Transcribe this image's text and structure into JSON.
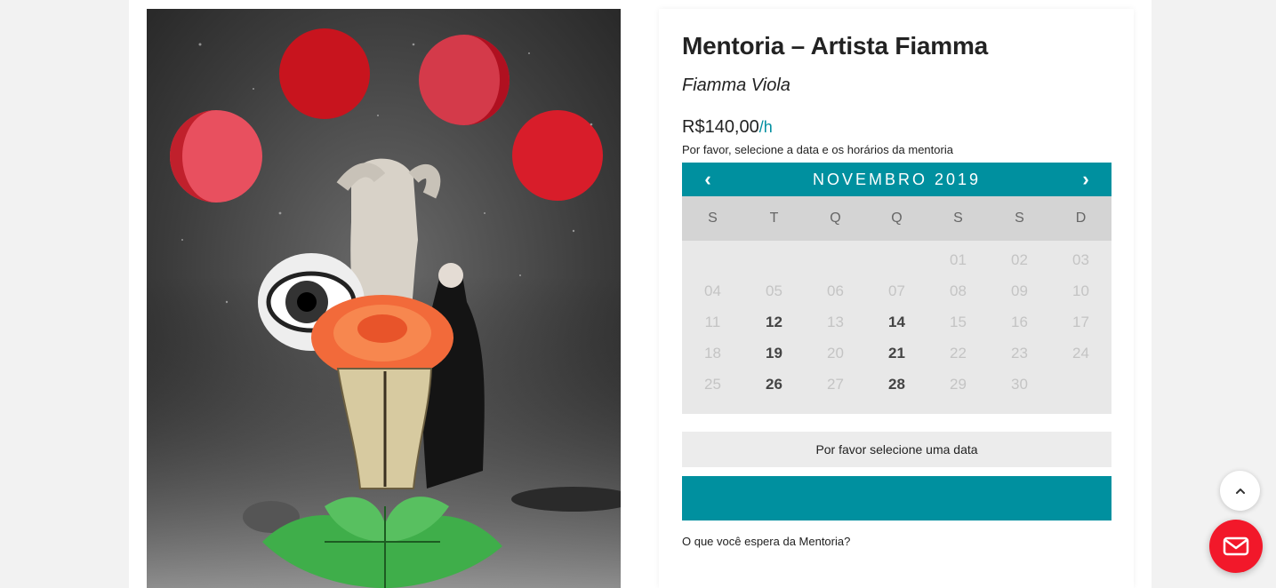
{
  "product": {
    "title": "Mentoria – Artista Fiamma",
    "artist": "Fiamma Viola",
    "price": "R$140,00",
    "price_unit": "/h",
    "instructions": "Por favor, selecione a data e os horários da mentoria"
  },
  "calendar": {
    "month_label": "NOVEMBRO 2019",
    "prev_label": "‹",
    "next_label": "›",
    "weekdays": [
      "S",
      "T",
      "Q",
      "Q",
      "S",
      "S",
      "D"
    ],
    "leading_blanks": 4,
    "days": [
      {
        "label": "01",
        "available": false
      },
      {
        "label": "02",
        "available": false
      },
      {
        "label": "03",
        "available": false
      },
      {
        "label": "04",
        "available": false
      },
      {
        "label": "05",
        "available": false
      },
      {
        "label": "06",
        "available": false
      },
      {
        "label": "07",
        "available": false
      },
      {
        "label": "08",
        "available": false
      },
      {
        "label": "09",
        "available": false
      },
      {
        "label": "10",
        "available": false
      },
      {
        "label": "11",
        "available": false
      },
      {
        "label": "12",
        "available": true
      },
      {
        "label": "13",
        "available": false
      },
      {
        "label": "14",
        "available": true
      },
      {
        "label": "15",
        "available": false
      },
      {
        "label": "16",
        "available": false
      },
      {
        "label": "17",
        "available": false
      },
      {
        "label": "18",
        "available": false
      },
      {
        "label": "19",
        "available": true
      },
      {
        "label": "20",
        "available": false
      },
      {
        "label": "21",
        "available": true
      },
      {
        "label": "22",
        "available": false
      },
      {
        "label": "23",
        "available": false
      },
      {
        "label": "24",
        "available": false
      },
      {
        "label": "25",
        "available": false
      },
      {
        "label": "26",
        "available": true
      },
      {
        "label": "27",
        "available": false
      },
      {
        "label": "28",
        "available": true
      },
      {
        "label": "29",
        "available": false
      },
      {
        "label": "30",
        "available": false
      }
    ]
  },
  "select_message": "Por favor selecione uma data",
  "question_label": "O que você espera da Mentoria?",
  "colors": {
    "accent": "#00909f",
    "mail_button": "#f2182a"
  },
  "icons": {
    "scroll_top": "chevron-up-icon",
    "mail": "envelope-icon"
  }
}
